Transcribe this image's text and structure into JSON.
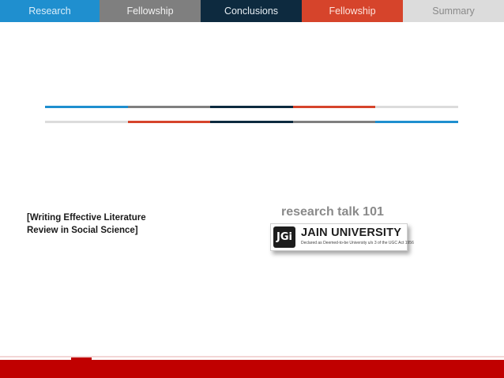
{
  "tabs": [
    {
      "label": "Research",
      "bg": "#1f8fcf",
      "color": "#dbeefa"
    },
    {
      "label": "Fellowship",
      "bg": "#7f7f7f",
      "color": "#f2f2f2"
    },
    {
      "label": "Conclusions",
      "bg": "#0d2a3f",
      "color": "#e6edf2"
    },
    {
      "label": "Fellowship",
      "bg": "#d6442b",
      "color": "#fde3dc"
    },
    {
      "label": "Summary",
      "bg": "#dcdcdc",
      "color": "#8a8a8a"
    }
  ],
  "decor_lines": {
    "top": [
      "#1f8fcf",
      "#7f7f7f",
      "#0d2a3f",
      "#d6442b",
      "#dcdcdc"
    ],
    "bottom": [
      "#dcdcdc",
      "#d6442b",
      "#0d2a3f",
      "#7f7f7f",
      "#1f8fcf"
    ]
  },
  "slide": {
    "left_title_line1": "[Writing Effective Literature",
    "left_title_line2": "Review in Social Science]",
    "talk_title": "research talk 101"
  },
  "logo": {
    "badge": "JGi",
    "name": "JAIN UNIVERSITY",
    "subtitle": "Declared as Deemed-to-be University u/s 3 of the UGC Act 1956"
  },
  "footer": {
    "color": "#c00000"
  }
}
